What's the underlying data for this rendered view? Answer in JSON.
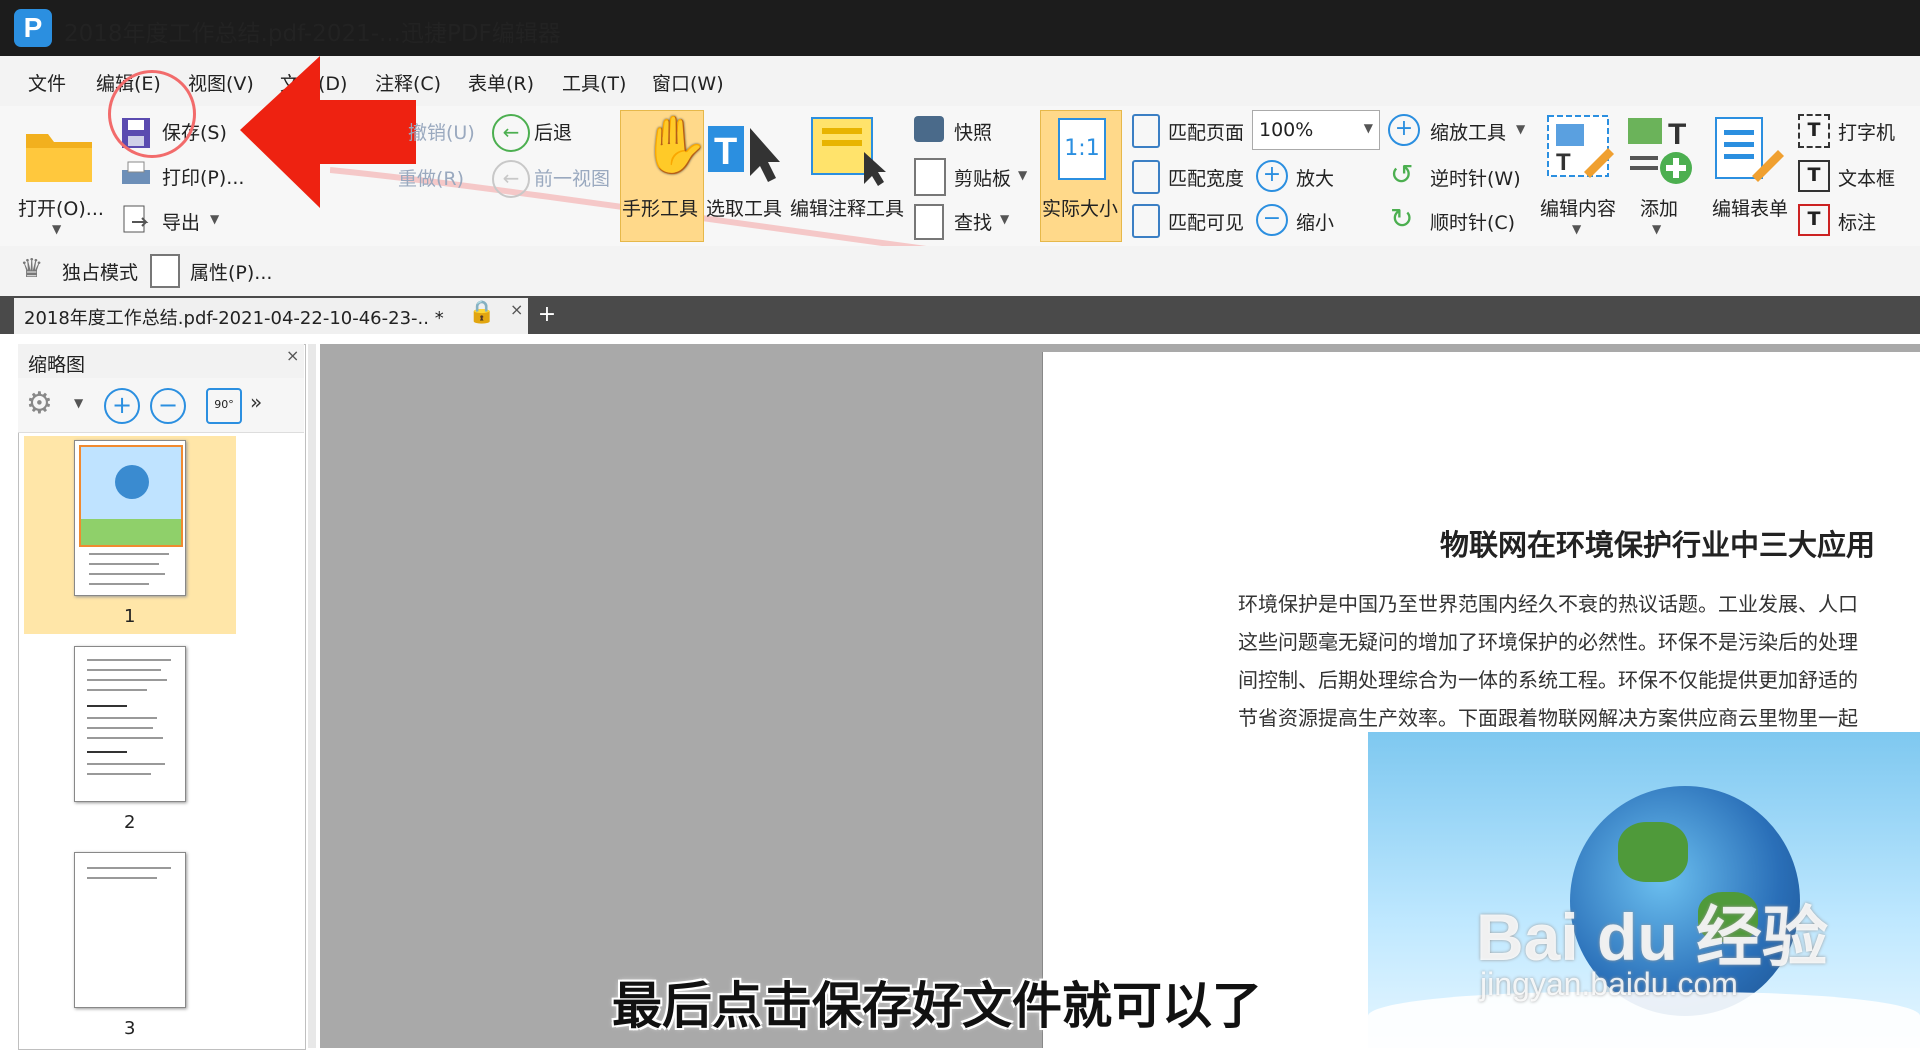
{
  "window": {
    "title": "2018年度工作总结.pdf-2021-...迅捷PDF编辑器",
    "logo": "P"
  },
  "menu": [
    "文件",
    "编辑(E)",
    "视图(V)",
    "文档(D)",
    "注释(C)",
    "表单(R)",
    "工具(T)",
    "窗口(W)"
  ],
  "ribbon": {
    "open": "打开(O)...",
    "save": "保存(S)",
    "print": "打印(P)...",
    "export": "导出",
    "undo": "撤销(U)",
    "redo": "重做(R)",
    "back": "后退",
    "prev_view": "前一视图",
    "hand_tool": "手形工具",
    "select_tool": "选取工具",
    "edit_annot_tool": "编辑注释工具",
    "snapshot": "快照",
    "clipboard": "剪贴板",
    "find": "查找",
    "actual_size": "实际大小",
    "actual_size_icon": "1:1",
    "fit_page": "匹配页面",
    "fit_width": "匹配宽度",
    "fit_visible": "匹配可见",
    "zoom_value": "100%",
    "zoom_tool": "缩放工具",
    "zoom_in": "放大",
    "zoom_out": "缩小",
    "rotate_ccw": "逆时针(W)",
    "rotate_cw": "顺时针(C)",
    "edit_content": "编辑内容",
    "add": "添加",
    "edit_form": "编辑表单",
    "typewriter": "打字机",
    "textbox": "文本框",
    "callout": "标注"
  },
  "quickbar": {
    "exclusive": "独占模式",
    "properties": "属性(P)..."
  },
  "tab": {
    "label": "2018年度工作总结.pdf-2021-04-22-10-46-23-.. *"
  },
  "thumbnails": {
    "title": "缩略图",
    "rotate_label": "90°",
    "pages": [
      "1",
      "2",
      "3"
    ]
  },
  "document": {
    "heading": "物联网在环境保护行业中三大应用",
    "lines": [
      "环境保护是中国乃至世界范围内经久不衰的热议话题。工业发展、人口",
      "这些问题毫无疑问的增加了环境保护的必然性。环保不是污染后的处理",
      "间控制、后期处理综合为一体的系统工程。环保不仅能提供更加舒适的",
      "节省资源提高生产效率。下面跟着物联网解决方案供应商云里物里一起"
    ],
    "watermark_main": "Bai du 经验",
    "watermark_sub": "jingyan.baidu.com"
  },
  "subtitle": "最后点击保存好文件就可以了",
  "colors": {
    "accent": "#2b8fe0",
    "arrow": "#ee2211",
    "selected": "#ffd98a",
    "titlebar": "#1c1c1c"
  }
}
